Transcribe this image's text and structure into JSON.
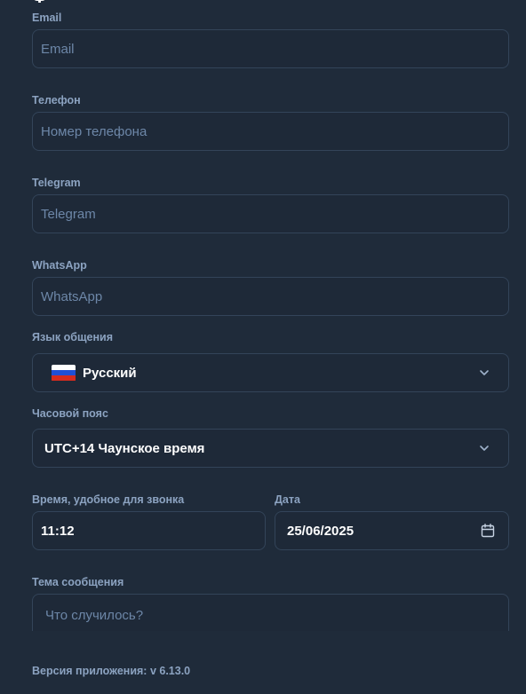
{
  "header": {
    "title_fragment": "Ф"
  },
  "form": {
    "email": {
      "label": "Email",
      "placeholder": "Email"
    },
    "phone": {
      "label": "Телефон",
      "placeholder": "Номер телефона"
    },
    "telegram": {
      "label": "Telegram",
      "placeholder": "Telegram"
    },
    "whatsapp": {
      "label": "WhatsApp",
      "placeholder": "WhatsApp"
    },
    "language": {
      "label": "Язык общения",
      "value": "Русский",
      "flag": "russia-flag"
    },
    "timezone": {
      "label": "Часовой пояс",
      "value": "UTC+14 Чаунское время"
    },
    "call_time": {
      "label": "Время, удобное для звонка",
      "value": "11:12"
    },
    "date": {
      "label": "Дата",
      "value": "25/06/2025"
    },
    "subject": {
      "label": "Тема сообщения",
      "placeholder": "Что случилось?"
    }
  },
  "footer": {
    "version": "Версия приложения: v 6.13.0"
  },
  "colors": {
    "background": "#1f2b3a",
    "field_bg": "#1e2938",
    "field_border": "#334459",
    "label": "#8ca3c1",
    "placeholder": "#6d87a8",
    "value": "#ffffff"
  },
  "icons": [
    "chevron-down-icon",
    "calendar-icon",
    "russia-flag-icon"
  ]
}
